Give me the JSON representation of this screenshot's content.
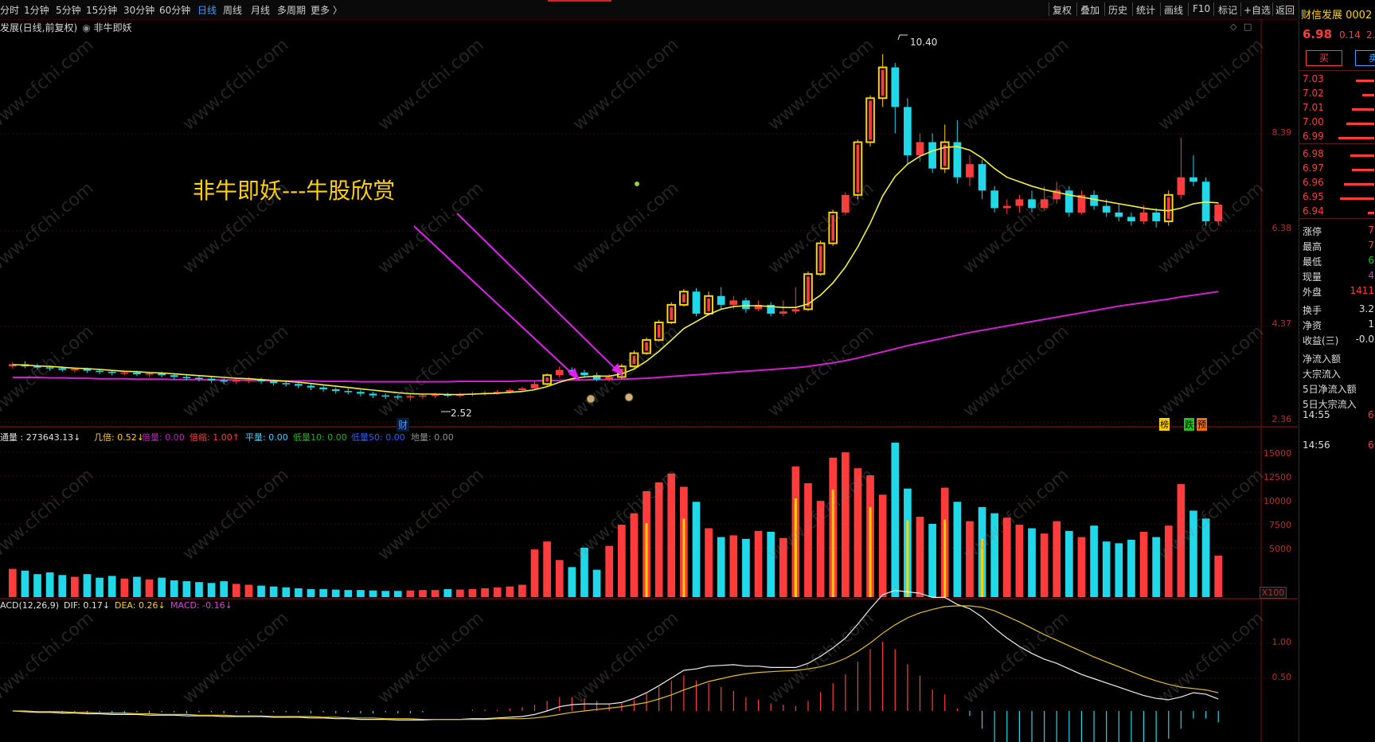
{
  "topbar": {
    "periods": [
      "分时",
      "1分钟",
      "5分钟",
      "15分钟",
      "30分钟",
      "60分钟",
      "日线",
      "周线",
      "月线",
      "多周期",
      "更多 〉"
    ],
    "active_period": "日线",
    "tools": [
      "复权",
      "叠加",
      "历史",
      "统计",
      "画线",
      "F10",
      "标记",
      "+自选",
      "返回"
    ]
  },
  "info": {
    "title": "发展(日线,前复权)",
    "indicator": "非牛即妖"
  },
  "annotation": "非牛即妖---牛股欣赏",
  "markers": {
    "high": "10.40",
    "low": "2.52",
    "badge_cai": "财",
    "badge_bang": "榜",
    "badge_die": "跌",
    "badge_yu": "预"
  },
  "price_axis": [
    "8.39",
    "6.38",
    "4.37",
    "2.36"
  ],
  "volume_axis": [
    "15000",
    "12500",
    "10000",
    "7500",
    "5000"
  ],
  "volume_unit": "X100",
  "macd_axis": [
    "1.00",
    "0.50"
  ],
  "volume_indicator": [
    {
      "label": "通量 : 273643.13↓",
      "color": "#e0e0e0"
    },
    {
      "label": "几倍: 0.52↓",
      "color": "#ffd200"
    },
    {
      "label": "倍量: 0.00",
      "color": "#c020c0"
    },
    {
      "label": "倍缩: 1.00↑",
      "color": "#ff3b3b"
    },
    {
      "label": "平量: 0.00",
      "color": "#3cd0ff"
    },
    {
      "label": "低量10: 0.00",
      "color": "#20b020"
    },
    {
      "label": "低量50: 0.00",
      "color": "#2060ff"
    },
    {
      "label": "地量: 0.00",
      "color": "#909090"
    }
  ],
  "macd_indicator": [
    {
      "label": "ACD(12,26,9)",
      "color": "#e0e0e0"
    },
    {
      "label": "DIF: 0.17↓",
      "color": "#e0e0e0"
    },
    {
      "label": "DEA: 0.26↓",
      "color": "#ffd200"
    },
    {
      "label": "MACD: -0.16↓",
      "color": "#e040e0"
    }
  ],
  "panel": {
    "title": "财信发展 0002",
    "price": "6.98",
    "change": "0.14",
    "pct": "2.0",
    "buy": "买",
    "sell": "卖",
    "orderbook": [
      {
        "price": "7.03",
        "vol": 0.45
      },
      {
        "price": "7.02",
        "vol": 0.3
      },
      {
        "price": "7.01",
        "vol": 0.55
      },
      {
        "price": "7.00",
        "vol": 0.7
      },
      {
        "price": "6.99",
        "vol": 0.9
      },
      {
        "price": "6.98",
        "vol": 0.6
      },
      {
        "price": "6.97",
        "vol": 0.55
      },
      {
        "price": "6.96",
        "vol": 0.75
      },
      {
        "price": "6.95",
        "vol": 0.85
      },
      {
        "price": "6.94",
        "vol": 0.15
      }
    ],
    "stats": [
      {
        "label": "涨停",
        "value": "7",
        "color": "#ff3b3b"
      },
      {
        "label": "最高",
        "value": "7",
        "color": "#ff3b3b"
      },
      {
        "label": "最低",
        "value": "6",
        "color": "#20c020"
      },
      {
        "label": "现量",
        "value": "4",
        "color": "#c040c0"
      },
      {
        "label": "外盘",
        "value": "1411",
        "color": "#ff3b3b"
      },
      {
        "label": "换手",
        "value": "3.2",
        "color": "#dcdcdc"
      },
      {
        "label": "净资",
        "value": "1",
        "color": "#dcdcdc"
      },
      {
        "label": "收益(三)",
        "value": "-0.0",
        "color": "#dcdcdc"
      },
      {
        "label": "净流入额",
        "value": "",
        "color": "#dcdcdc"
      },
      {
        "label": "大宗流入",
        "value": "",
        "color": "#dcdcdc"
      },
      {
        "label": "5日净流入额",
        "value": "",
        "color": "#dcdcdc"
      },
      {
        "label": "5日大宗流入",
        "value": "",
        "color": "#dcdcdc"
      }
    ],
    "ticks": [
      {
        "time": "14:55",
        "value": "6"
      },
      {
        "time": "14:56",
        "value": "6"
      }
    ]
  },
  "watermark": "www.cfchi.com",
  "chart_data": {
    "type": "candlestick",
    "ylim": [
      2.0,
      10.8
    ],
    "candles": [
      [
        3.3,
        3.35,
        3.4,
        3.25
      ],
      [
        3.35,
        3.3,
        3.42,
        3.26
      ],
      [
        3.3,
        3.28,
        3.36,
        3.22
      ],
      [
        3.28,
        3.26,
        3.32,
        3.2
      ],
      [
        3.26,
        3.22,
        3.3,
        3.18
      ],
      [
        3.22,
        3.24,
        3.28,
        3.16
      ],
      [
        3.24,
        3.2,
        3.27,
        3.15
      ],
      [
        3.2,
        3.18,
        3.25,
        3.12
      ],
      [
        3.18,
        3.15,
        3.22,
        3.1
      ],
      [
        3.15,
        3.16,
        3.2,
        3.1
      ],
      [
        3.16,
        3.12,
        3.2,
        3.08
      ],
      [
        3.12,
        3.14,
        3.18,
        3.06
      ],
      [
        3.14,
        3.1,
        3.18,
        3.05
      ],
      [
        3.1,
        3.06,
        3.13,
        3.0
      ],
      [
        3.06,
        3.04,
        3.1,
        2.98
      ],
      [
        3.04,
        3.02,
        3.08,
        2.96
      ],
      [
        3.02,
        2.98,
        3.06,
        2.92
      ],
      [
        2.98,
        2.96,
        3.03,
        2.9
      ],
      [
        2.96,
        2.98,
        3.04,
        2.9
      ],
      [
        2.98,
        3.0,
        3.05,
        2.92
      ],
      [
        3.0,
        2.96,
        3.04,
        2.9
      ],
      [
        2.96,
        2.92,
        3.0,
        2.86
      ],
      [
        2.92,
        2.9,
        2.98,
        2.84
      ],
      [
        2.9,
        2.86,
        2.94,
        2.8
      ],
      [
        2.86,
        2.82,
        2.9,
        2.76
      ],
      [
        2.82,
        2.78,
        2.86,
        2.72
      ],
      [
        2.78,
        2.74,
        2.82,
        2.68
      ],
      [
        2.74,
        2.72,
        2.8,
        2.66
      ],
      [
        2.72,
        2.68,
        2.76,
        2.62
      ],
      [
        2.68,
        2.64,
        2.72,
        2.58
      ],
      [
        2.64,
        2.62,
        2.68,
        2.56
      ],
      [
        2.62,
        2.6,
        2.66,
        2.54
      ],
      [
        2.6,
        2.62,
        2.66,
        2.52
      ],
      [
        2.62,
        2.64,
        2.68,
        2.56
      ],
      [
        2.64,
        2.66,
        2.7,
        2.58
      ],
      [
        2.66,
        2.64,
        2.7,
        2.6
      ],
      [
        2.64,
        2.66,
        2.7,
        2.6
      ],
      [
        2.66,
        2.68,
        2.72,
        2.62
      ],
      [
        2.68,
        2.7,
        2.74,
        2.64
      ],
      [
        2.7,
        2.72,
        2.76,
        2.66
      ],
      [
        2.72,
        2.76,
        2.8,
        2.68
      ],
      [
        2.76,
        2.8,
        2.84,
        2.72
      ],
      [
        2.8,
        2.9,
        2.96,
        2.76
      ],
      [
        2.9,
        3.1,
        3.14,
        2.86
      ],
      [
        3.1,
        3.22,
        3.3,
        3.04
      ],
      [
        3.22,
        3.16,
        3.28,
        3.08
      ],
      [
        3.16,
        3.1,
        3.22,
        3.04
      ],
      [
        3.1,
        3.0,
        3.16,
        2.96
      ],
      [
        3.0,
        3.06,
        3.12,
        2.96
      ],
      [
        3.06,
        3.3,
        3.36,
        3.02
      ],
      [
        3.3,
        3.6,
        3.66,
        3.26
      ],
      [
        3.6,
        3.9,
        3.96,
        3.56
      ],
      [
        3.9,
        4.3,
        4.36,
        3.86
      ],
      [
        4.3,
        4.7,
        4.76,
        4.26
      ],
      [
        4.7,
        5.0,
        5.06,
        4.66
      ],
      [
        5.0,
        4.5,
        5.08,
        4.44
      ],
      [
        4.5,
        4.9,
        5.0,
        4.46
      ],
      [
        4.9,
        4.7,
        5.1,
        4.6
      ],
      [
        4.7,
        4.8,
        4.9,
        4.6
      ],
      [
        4.8,
        4.6,
        4.86,
        4.52
      ],
      [
        4.6,
        4.7,
        4.8,
        4.56
      ],
      [
        4.7,
        4.5,
        4.76,
        4.44
      ],
      [
        4.5,
        4.55,
        4.8,
        4.44
      ],
      [
        4.55,
        4.6,
        5.1,
        4.5
      ],
      [
        4.6,
        5.4,
        5.46,
        4.56
      ],
      [
        5.4,
        6.1,
        6.16,
        5.36
      ],
      [
        6.1,
        6.8,
        6.86,
        6.04
      ],
      [
        6.8,
        7.2,
        7.26,
        6.74
      ],
      [
        7.2,
        8.4,
        8.46,
        7.1
      ],
      [
        8.4,
        9.4,
        9.46,
        8.3
      ],
      [
        9.4,
        10.1,
        10.4,
        9.2
      ],
      [
        10.1,
        9.2,
        10.2,
        8.6
      ],
      [
        9.2,
        8.1,
        9.4,
        7.9
      ],
      [
        8.1,
        8.4,
        8.6,
        7.96
      ],
      [
        8.4,
        7.8,
        8.6,
        7.7
      ],
      [
        7.8,
        8.4,
        8.8,
        7.7
      ],
      [
        8.4,
        7.6,
        8.9,
        7.46
      ],
      [
        7.6,
        7.9,
        8.1,
        7.4
      ],
      [
        7.9,
        7.3,
        8.0,
        7.1
      ],
      [
        7.3,
        6.9,
        7.4,
        6.8
      ],
      [
        6.9,
        6.95,
        7.1,
        6.76
      ],
      [
        6.95,
        7.1,
        7.2,
        6.8
      ],
      [
        7.1,
        6.9,
        7.3,
        6.8
      ],
      [
        6.9,
        7.1,
        7.4,
        6.86
      ],
      [
        7.1,
        7.3,
        7.5,
        7.0
      ],
      [
        7.3,
        6.8,
        7.4,
        6.7
      ],
      [
        6.8,
        7.2,
        7.3,
        6.76
      ],
      [
        7.2,
        6.95,
        7.3,
        6.86
      ],
      [
        6.95,
        6.8,
        7.1,
        6.7
      ],
      [
        6.8,
        6.7,
        7.0,
        6.6
      ],
      [
        6.7,
        6.6,
        6.8,
        6.5
      ],
      [
        6.6,
        6.8,
        6.96,
        6.54
      ],
      [
        6.8,
        6.6,
        6.9,
        6.46
      ],
      [
        6.6,
        7.2,
        7.3,
        6.5
      ],
      [
        7.2,
        7.6,
        8.5,
        7.1
      ],
      [
        7.6,
        7.5,
        8.1,
        7.4
      ],
      [
        7.5,
        6.6,
        7.6,
        6.5
      ],
      [
        6.6,
        6.98,
        7.03,
        6.5
      ]
    ],
    "ma_short": [
      3.34,
      3.33,
      3.31,
      3.3,
      3.28,
      3.26,
      3.25,
      3.23,
      3.21,
      3.19,
      3.18,
      3.16,
      3.15,
      3.13,
      3.11,
      3.09,
      3.07,
      3.05,
      3.03,
      3.02,
      3.0,
      2.98,
      2.96,
      2.94,
      2.91,
      2.88,
      2.85,
      2.82,
      2.79,
      2.76,
      2.73,
      2.7,
      2.68,
      2.67,
      2.67,
      2.66,
      2.66,
      2.67,
      2.68,
      2.69,
      2.71,
      2.73,
      2.77,
      2.84,
      2.94,
      3.02,
      3.06,
      3.08,
      3.08,
      3.13,
      3.24,
      3.42,
      3.64,
      3.9,
      4.16,
      4.32,
      4.48,
      4.6,
      4.66,
      4.68,
      4.68,
      4.66,
      4.64,
      4.64,
      4.72,
      4.92,
      5.2,
      5.56,
      6.02,
      6.56,
      7.18,
      7.62,
      7.9,
      8.08,
      8.2,
      8.28,
      8.3,
      8.22,
      8.04,
      7.8,
      7.6,
      7.5,
      7.4,
      7.32,
      7.26,
      7.2,
      7.15,
      7.1,
      7.05,
      7.0,
      6.95,
      6.9,
      6.86,
      6.84,
      6.9,
      7.0,
      7.04,
      7.02
    ],
    "ma_long": [
      3.05,
      3.05,
      3.05,
      3.04,
      3.04,
      3.03,
      3.03,
      3.02,
      3.02,
      3.02,
      3.01,
      3.01,
      3.01,
      3.0,
      3.0,
      3.0,
      2.99,
      2.99,
      2.99,
      2.98,
      2.98,
      2.98,
      2.97,
      2.97,
      2.97,
      2.96,
      2.96,
      2.96,
      2.95,
      2.95,
      2.95,
      2.95,
      2.95,
      2.95,
      2.95,
      2.95,
      2.96,
      2.96,
      2.96,
      2.96,
      2.96,
      2.97,
      2.97,
      2.98,
      2.98,
      2.99,
      2.99,
      3.0,
      3.0,
      3.01,
      3.02,
      3.03,
      3.05,
      3.07,
      3.09,
      3.11,
      3.13,
      3.15,
      3.17,
      3.19,
      3.21,
      3.23,
      3.25,
      3.27,
      3.3,
      3.34,
      3.38,
      3.43,
      3.49,
      3.56,
      3.63,
      3.7,
      3.77,
      3.83,
      3.89,
      3.95,
      4.01,
      4.07,
      4.12,
      4.17,
      4.22,
      4.27,
      4.32,
      4.37,
      4.42,
      4.47,
      4.52,
      4.57,
      4.62,
      4.67,
      4.71,
      4.75,
      4.79,
      4.83,
      4.88,
      4.92,
      4.96,
      5.0
    ],
    "volume": [
      3200,
      3000,
      2600,
      2800,
      2500,
      2300,
      2600,
      2200,
      2400,
      2100,
      2300,
      2000,
      2200,
      1900,
      1800,
      1700,
      1600,
      1800,
      1500,
      1400,
      1300,
      1200,
      1100,
      1000,
      900,
      900,
      850,
      800,
      800,
      750,
      700,
      700,
      750,
      800,
      800,
      900,
      850,
      900,
      1000,
      1100,
      1200,
      1400,
      5400,
      6300,
      4200,
      3400,
      5600,
      3100,
      5800,
      8200,
      9500,
      12000,
      13000,
      14000,
      12500,
      10800,
      7800,
      6800,
      7000,
      6600,
      7500,
      7400,
      6700,
      14800,
      12900,
      10900,
      15800,
      16400,
      14600,
      13800,
      11600,
      17500,
      12300,
      9100,
      8300,
      12400,
      10800,
      8600,
      10200,
      9500,
      9000,
      8200,
      7800,
      7200,
      8600,
      7500,
      6800,
      8100,
      6300,
      6100,
      6500,
      7400,
      6800,
      8100,
      12800,
      9800,
      8900,
      4700
    ],
    "dif": [
      0.0,
      -0.01,
      -0.02,
      -0.02,
      -0.03,
      -0.03,
      -0.04,
      -0.04,
      -0.05,
      -0.05,
      -0.05,
      -0.06,
      -0.06,
      -0.06,
      -0.07,
      -0.07,
      -0.07,
      -0.08,
      -0.08,
      -0.08,
      -0.08,
      -0.09,
      -0.09,
      -0.09,
      -0.1,
      -0.1,
      -0.11,
      -0.11,
      -0.12,
      -0.12,
      -0.12,
      -0.13,
      -0.13,
      -0.13,
      -0.12,
      -0.12,
      -0.12,
      -0.11,
      -0.11,
      -0.1,
      -0.09,
      -0.08,
      -0.05,
      0.0,
      0.06,
      0.09,
      0.1,
      0.1,
      0.1,
      0.12,
      0.18,
      0.26,
      0.36,
      0.47,
      0.58,
      0.6,
      0.64,
      0.65,
      0.66,
      0.64,
      0.64,
      0.62,
      0.62,
      0.62,
      0.68,
      0.78,
      0.9,
      1.04,
      1.24,
      1.46,
      1.66,
      1.72,
      1.7,
      1.68,
      1.62,
      1.62,
      1.52,
      1.46,
      1.34,
      1.18,
      1.04,
      0.92,
      0.82,
      0.74,
      0.68,
      0.6,
      0.52,
      0.46,
      0.4,
      0.34,
      0.28,
      0.22,
      0.18,
      0.16,
      0.2,
      0.26,
      0.24,
      0.17
    ],
    "dea": [
      0.0,
      0.0,
      -0.01,
      -0.01,
      -0.01,
      -0.02,
      -0.02,
      -0.03,
      -0.03,
      -0.03,
      -0.04,
      -0.04,
      -0.05,
      -0.05,
      -0.05,
      -0.06,
      -0.06,
      -0.06,
      -0.07,
      -0.07,
      -0.07,
      -0.08,
      -0.08,
      -0.08,
      -0.08,
      -0.09,
      -0.09,
      -0.1,
      -0.1,
      -0.1,
      -0.11,
      -0.11,
      -0.11,
      -0.12,
      -0.12,
      -0.12,
      -0.12,
      -0.12,
      -0.12,
      -0.11,
      -0.11,
      -0.11,
      -0.1,
      -0.08,
      -0.05,
      -0.02,
      0.0,
      0.02,
      0.04,
      0.06,
      0.09,
      0.12,
      0.17,
      0.23,
      0.3,
      0.36,
      0.42,
      0.46,
      0.5,
      0.53,
      0.55,
      0.56,
      0.57,
      0.58,
      0.6,
      0.63,
      0.68,
      0.75,
      0.85,
      0.97,
      1.11,
      1.23,
      1.33,
      1.4,
      1.45,
      1.49,
      1.5,
      1.5,
      1.48,
      1.43,
      1.35,
      1.27,
      1.18,
      1.09,
      1.01,
      0.93,
      0.85,
      0.77,
      0.7,
      0.63,
      0.56,
      0.49,
      0.43,
      0.38,
      0.34,
      0.32,
      0.3,
      0.26
    ]
  }
}
